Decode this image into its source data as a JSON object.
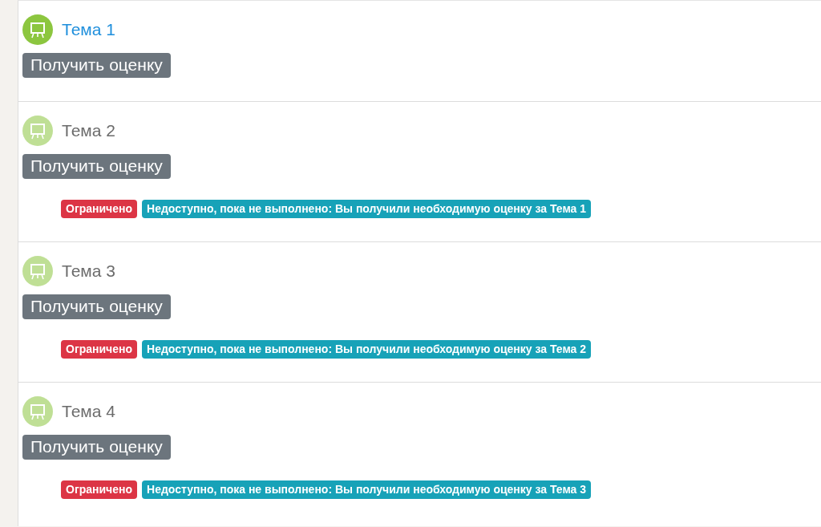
{
  "topics": [
    {
      "title": "Тема 1",
      "available": true,
      "button": "Получить оценку"
    },
    {
      "title": "Тема 2",
      "available": false,
      "button": "Получить оценку",
      "restriction": {
        "badge": "Ограничено",
        "text": "Недоступно, пока не выполнено: Вы получили необходимую оценку за **Тема 1**"
      }
    },
    {
      "title": "Тема 3",
      "available": false,
      "button": "Получить оценку",
      "restriction": {
        "badge": "Ограничено",
        "text": "Недоступно, пока не выполнено: Вы получили необходимую оценку за **Тема 2**"
      }
    },
    {
      "title": "Тема 4",
      "available": false,
      "button": "Получить оценку",
      "restriction": {
        "badge": "Ограничено",
        "text": "Недоступно, пока не выполнено: Вы получили необходимую оценку за **Тема 3**"
      }
    }
  ]
}
